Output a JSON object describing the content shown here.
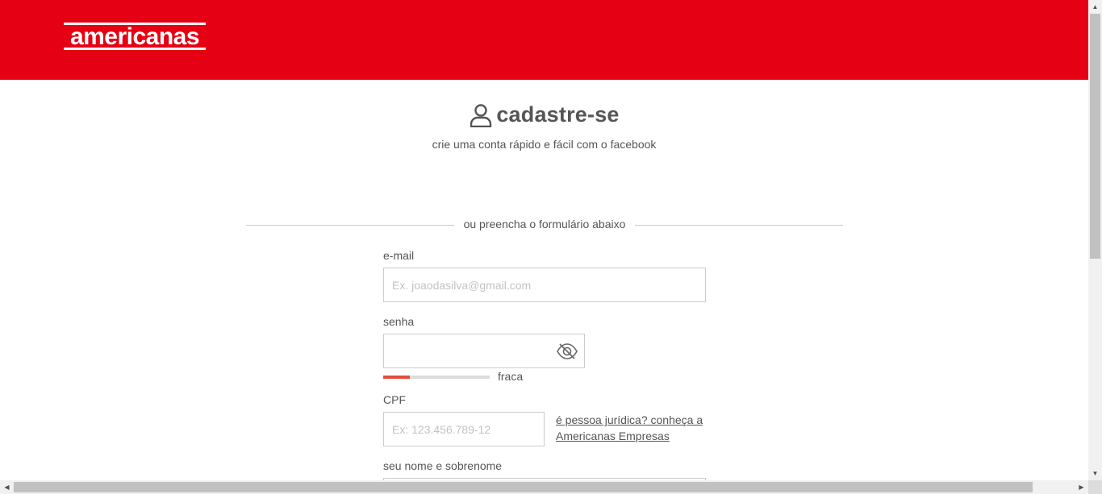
{
  "header": {
    "logo_text": "americanas",
    "brand_color": "#e60014"
  },
  "page": {
    "title": "cadastre-se",
    "subtitle": "crie uma conta rápido e fácil com o facebook",
    "divider_text": "ou preencha o formulário abaixo"
  },
  "form": {
    "email": {
      "label": "e-mail",
      "placeholder": "Ex. joaodasilva@gmail.com",
      "value": ""
    },
    "password": {
      "label": "senha",
      "value": "",
      "toggle_icon": "eye-off-icon",
      "strength_label": "fraca",
      "strength_level": 0.25,
      "strength_color": "#e54a3a"
    },
    "cpf": {
      "label": "CPF",
      "placeholder": "Ex: 123.456.789-12",
      "value": ""
    },
    "pj_link": "é pessoa jurídica? conheça a Americanas Empresas",
    "name": {
      "label": "seu nome e sobrenome",
      "value": ""
    }
  },
  "icons": {
    "user": "user-icon",
    "eye": "eye-off-icon"
  }
}
